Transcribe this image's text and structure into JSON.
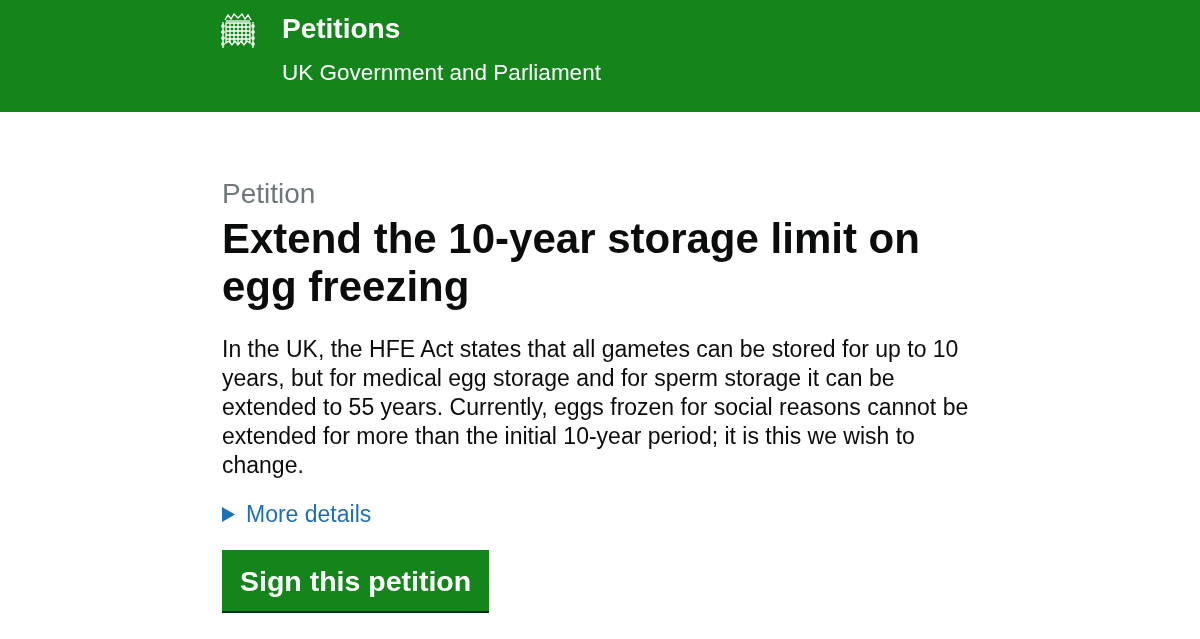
{
  "header": {
    "title": "Petitions",
    "subtitle": "UK Government and Parliament"
  },
  "petition": {
    "caption": "Petition",
    "title": "Extend the 10-year storage limit on egg freezing",
    "summary": "In the UK, the HFE Act states that all gametes can be stored for up to 10 years, but for medical egg storage and for sperm storage it can be extended to 55 years. Currently, eggs frozen for social reasons cannot be extended for more than the initial 10-year period; it is this we wish to change.",
    "details": {
      "label": "More details",
      "expanded": false
    },
    "sign_button": {
      "label": "Sign this petition"
    }
  }
}
